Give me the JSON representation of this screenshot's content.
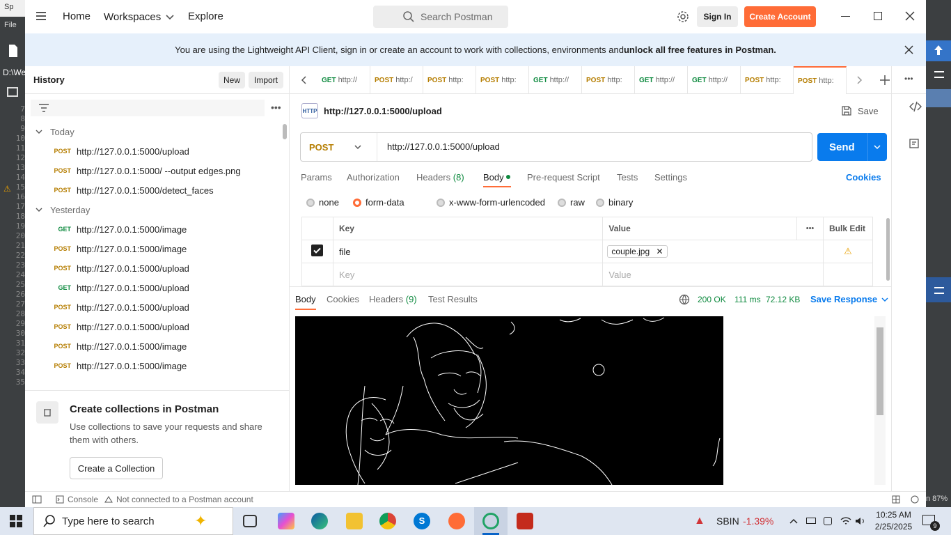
{
  "ide": {
    "title_fragment": "Sp",
    "menu_file": "File",
    "path_fragment": "D:\\We",
    "line_numbers": [
      "7",
      "8",
      "9",
      "10",
      "11",
      "12",
      "13",
      "14",
      "15",
      "16",
      "17",
      "18",
      "19",
      "20",
      "21",
      "22",
      "23",
      "24",
      "25",
      "26",
      "27",
      "28",
      "29",
      "30",
      "31",
      "32",
      "33",
      "34",
      "35"
    ],
    "zoom_fragment": "n 87%"
  },
  "titlebar": {
    "home": "Home",
    "workspaces": "Workspaces",
    "explore": "Explore",
    "search_placeholder": "Search Postman",
    "sign_in": "Sign In",
    "create_account": "Create Account"
  },
  "banner": {
    "text": "You are using the Lightweight API Client, sign in or create an account to work with collections, environments and ",
    "bold_text": "unlock all free features in Postman."
  },
  "sidebar": {
    "title": "History",
    "new_label": "New",
    "import_label": "Import",
    "groups": [
      {
        "label": "Today",
        "items": [
          {
            "method": "POST",
            "url": "http://127.0.0.1:5000/upload"
          },
          {
            "method": "POST",
            "url": "http://127.0.0.1:5000/ --output edges.png"
          },
          {
            "method": "POST",
            "url": "http://127.0.0.1:5000/detect_faces"
          }
        ]
      },
      {
        "label": "Yesterday",
        "items": [
          {
            "method": "GET",
            "url": "http://127.0.0.1:5000/image"
          },
          {
            "method": "POST",
            "url": "http://127.0.0.1:5000/image"
          },
          {
            "method": "POST",
            "url": "http://127.0.0.1:5000/upload"
          },
          {
            "method": "GET",
            "url": "http://127.0.0.1:5000/upload"
          },
          {
            "method": "POST",
            "url": "http://127.0.0.1:5000/upload"
          },
          {
            "method": "POST",
            "url": "http://127.0.0.1:5000/upload"
          },
          {
            "method": "POST",
            "url": "http://127.0.0.1:5000/image"
          },
          {
            "method": "POST",
            "url": "http://127.0.0.1:5000/image"
          }
        ]
      }
    ],
    "promo_title": "Create collections in Postman",
    "promo_text": "Use collections to save your requests and share them with others.",
    "promo_button": "Create a Collection"
  },
  "tabs": [
    {
      "method": "GET",
      "url": "http://"
    },
    {
      "method": "POST",
      "url": "http:/"
    },
    {
      "method": "POST",
      "url": "http:"
    },
    {
      "method": "POST",
      "url": "http:"
    },
    {
      "method": "GET",
      "url": "http://"
    },
    {
      "method": "POST",
      "url": "http:"
    },
    {
      "method": "GET",
      "url": "http://"
    },
    {
      "method": "GET",
      "url": "http://"
    },
    {
      "method": "POST",
      "url": "http:"
    },
    {
      "method": "POST",
      "url": "http:"
    }
  ],
  "request": {
    "http_badge": "HTTP",
    "title": "http://127.0.0.1:5000/upload",
    "save": "Save",
    "method": "POST",
    "url": "http://127.0.0.1:5000/upload",
    "send": "Send",
    "subtabs": {
      "params": "Params",
      "authorization": "Authorization",
      "headers": "Headers",
      "headers_count": "(8)",
      "body": "Body",
      "prerequest": "Pre-request Script",
      "tests": "Tests",
      "settings": "Settings",
      "cookies": "Cookies"
    },
    "body_types": [
      "none",
      "form-data",
      "x-www-form-urlencoded",
      "raw",
      "binary"
    ],
    "body_selected": "form-data",
    "table": {
      "key_header": "Key",
      "value_header": "Value",
      "bulk_edit": "Bulk Edit",
      "rows": [
        {
          "key": "file",
          "value": "couple.jpg",
          "checked": true
        }
      ],
      "key_placeholder": "Key",
      "value_placeholder": "Value"
    }
  },
  "response": {
    "tabs": {
      "body": "Body",
      "cookies": "Cookies",
      "headers": "Headers",
      "headers_count": "(9)",
      "test_results": "Test Results"
    },
    "status": "200 OK",
    "time": "111 ms",
    "size": "72.12 KB",
    "save_response": "Save Response"
  },
  "statusbar": {
    "console": "Console",
    "connection": "Not connected to a Postman account"
  },
  "taskbar": {
    "search_placeholder": "Type here to search",
    "stock_name": "SBIN",
    "stock_change": "-1.39%",
    "time": "10:25 AM",
    "date": "2/25/2025",
    "notification_count": "9"
  },
  "colors": {
    "accent": "#ff6c37",
    "send": "#097bed",
    "post": "#b57d00",
    "get": "#0e8a3f",
    "ok": "#0e8a3f",
    "stock_down": "#d13438"
  }
}
